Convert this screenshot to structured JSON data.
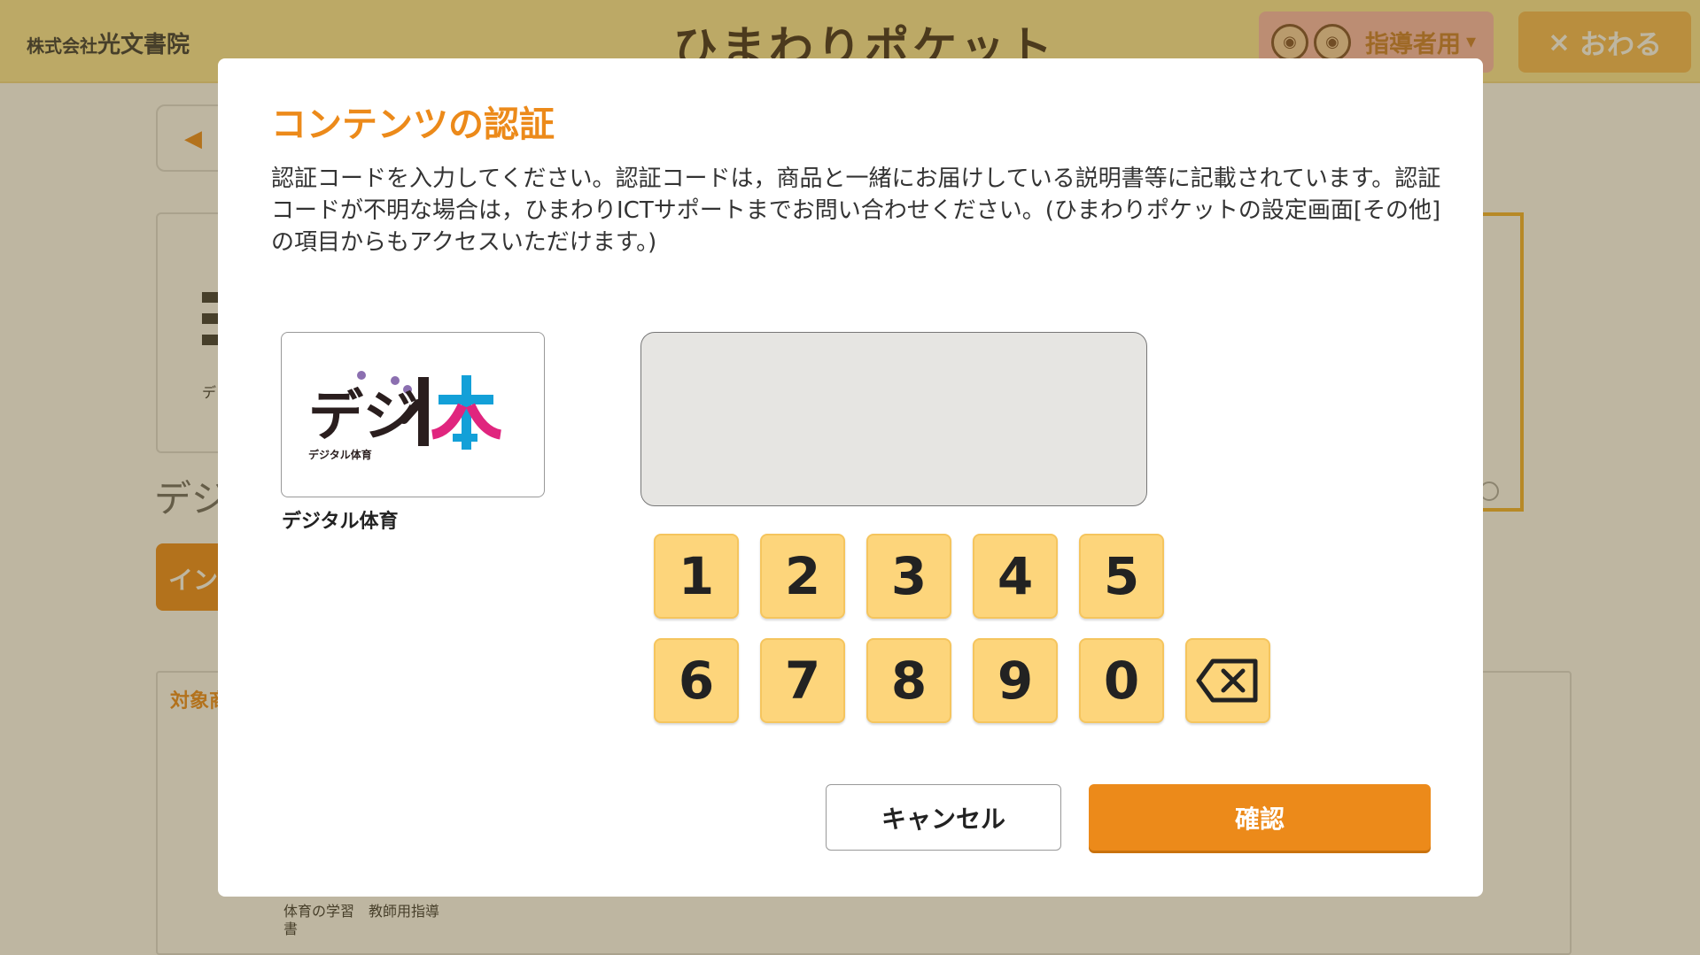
{
  "header": {
    "brand_prefix": "株式会社",
    "brand_name": "光文書院",
    "app_title": "ひまわりポケット",
    "user_label": "指導者用",
    "user_caret": "▾",
    "exit_label": "おわる",
    "exit_icon": "×"
  },
  "background": {
    "back_arrow": "◀",
    "card_small_text": "デ",
    "page_title": "デジ",
    "install_label": "イン",
    "panel_title": "対象商",
    "book_title": "体育の学習　教師用指導書"
  },
  "modal": {
    "title": "コンテンツの認証",
    "description": "認証コードを入力してください。認証コードは，商品と一緒にお届けしている説明書等に記載されています。認証コードが不明な場合は，ひまわりICTサポートまでお問い合わせください。(ひまわりポケットの設定画面[その他]の項目からもアクセスいただけます。)",
    "product": {
      "logo_text": "デジ体",
      "logo_subtext": "デジタル体育",
      "name": "デジタル体育"
    },
    "code_input_value": "",
    "keypad": [
      "1",
      "2",
      "3",
      "4",
      "5",
      "6",
      "7",
      "8",
      "9",
      "0"
    ],
    "backspace_icon": "backspace-icon",
    "cancel_label": "キャンセル",
    "confirm_label": "確認"
  },
  "colors": {
    "accent": "#ec8a1a",
    "key_fill": "#fdd57b",
    "header_bg": "#fbe99a"
  }
}
